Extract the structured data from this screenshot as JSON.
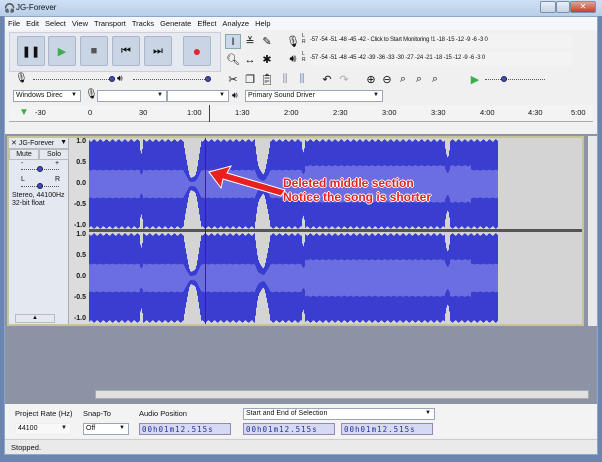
{
  "window": {
    "title": "JG-Forever"
  },
  "menu": [
    "File",
    "Edit",
    "Select",
    "View",
    "Transport",
    "Tracks",
    "Generate",
    "Effect",
    "Analyze",
    "Help"
  ],
  "meters": {
    "record_scale": "-57 -54 -51 -48 -45 -42 - Click to Start Monitoring !1 -18 -15 -12 -9 -6 -3 0",
    "play_scale": "-57 -54 -51 -48 -45 -42 -39 -36 -33 -30 -27 -24 -21 -18 -15 -12 -9 -6 -3 0",
    "lr": [
      "L",
      "R"
    ]
  },
  "device": {
    "host": "Windows Direc",
    "input": "",
    "channels": "",
    "output": "Primary Sound Driver"
  },
  "ruler": [
    "-30",
    "0",
    "30",
    "1:00",
    "1:30",
    "2:00",
    "2:30",
    "3:00",
    "3:30",
    "4:00",
    "4:30",
    "5:00"
  ],
  "track": {
    "name": "JG-Forever",
    "mute": "Mute",
    "solo": "Solo",
    "gain_min": "-",
    "gain_max": "+",
    "pan_left": "L",
    "pan_right": "R",
    "info1": "Stereo, 44100Hz",
    "info2": "32-bit float",
    "scale": [
      "1.0",
      "0.5",
      "0.0",
      "-0.5",
      "-1.0"
    ]
  },
  "annotation": {
    "line1": "Deleted middle section",
    "line2": "Notice the song is shorter"
  },
  "selectionbar": {
    "rate_label": "Project Rate (Hz)",
    "rate": "44100",
    "snap_label": "Snap-To",
    "snap": "Off",
    "pos_label": "Audio Position",
    "pos": "00h01m12.515s",
    "sel_mode": "Start and End of Selection",
    "sel_start": "00h01m12.515s",
    "sel_end": "00h01m12.515s"
  },
  "status": "Stopped."
}
